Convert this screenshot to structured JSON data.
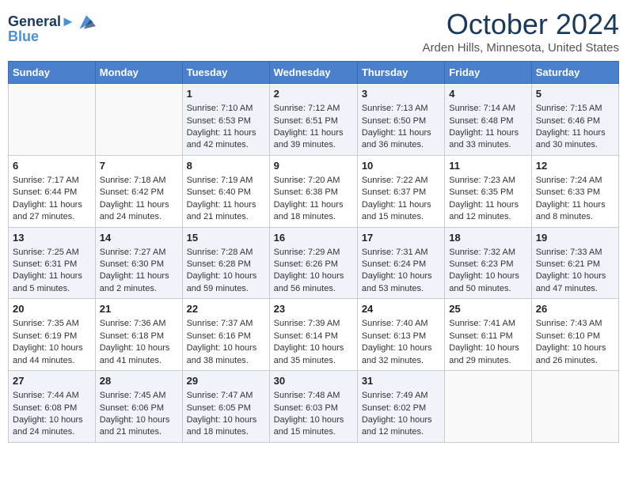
{
  "header": {
    "logo_line1": "General",
    "logo_line2": "Blue",
    "month_title": "October 2024",
    "location": "Arden Hills, Minnesota, United States"
  },
  "days_of_week": [
    "Sunday",
    "Monday",
    "Tuesday",
    "Wednesday",
    "Thursday",
    "Friday",
    "Saturday"
  ],
  "weeks": [
    [
      {
        "day": "",
        "sunrise": "",
        "sunset": "",
        "daylight": ""
      },
      {
        "day": "",
        "sunrise": "",
        "sunset": "",
        "daylight": ""
      },
      {
        "day": "1",
        "sunrise": "Sunrise: 7:10 AM",
        "sunset": "Sunset: 6:53 PM",
        "daylight": "Daylight: 11 hours and 42 minutes."
      },
      {
        "day": "2",
        "sunrise": "Sunrise: 7:12 AM",
        "sunset": "Sunset: 6:51 PM",
        "daylight": "Daylight: 11 hours and 39 minutes."
      },
      {
        "day": "3",
        "sunrise": "Sunrise: 7:13 AM",
        "sunset": "Sunset: 6:50 PM",
        "daylight": "Daylight: 11 hours and 36 minutes."
      },
      {
        "day": "4",
        "sunrise": "Sunrise: 7:14 AM",
        "sunset": "Sunset: 6:48 PM",
        "daylight": "Daylight: 11 hours and 33 minutes."
      },
      {
        "day": "5",
        "sunrise": "Sunrise: 7:15 AM",
        "sunset": "Sunset: 6:46 PM",
        "daylight": "Daylight: 11 hours and 30 minutes."
      }
    ],
    [
      {
        "day": "6",
        "sunrise": "Sunrise: 7:17 AM",
        "sunset": "Sunset: 6:44 PM",
        "daylight": "Daylight: 11 hours and 27 minutes."
      },
      {
        "day": "7",
        "sunrise": "Sunrise: 7:18 AM",
        "sunset": "Sunset: 6:42 PM",
        "daylight": "Daylight: 11 hours and 24 minutes."
      },
      {
        "day": "8",
        "sunrise": "Sunrise: 7:19 AM",
        "sunset": "Sunset: 6:40 PM",
        "daylight": "Daylight: 11 hours and 21 minutes."
      },
      {
        "day": "9",
        "sunrise": "Sunrise: 7:20 AM",
        "sunset": "Sunset: 6:38 PM",
        "daylight": "Daylight: 11 hours and 18 minutes."
      },
      {
        "day": "10",
        "sunrise": "Sunrise: 7:22 AM",
        "sunset": "Sunset: 6:37 PM",
        "daylight": "Daylight: 11 hours and 15 minutes."
      },
      {
        "day": "11",
        "sunrise": "Sunrise: 7:23 AM",
        "sunset": "Sunset: 6:35 PM",
        "daylight": "Daylight: 11 hours and 12 minutes."
      },
      {
        "day": "12",
        "sunrise": "Sunrise: 7:24 AM",
        "sunset": "Sunset: 6:33 PM",
        "daylight": "Daylight: 11 hours and 8 minutes."
      }
    ],
    [
      {
        "day": "13",
        "sunrise": "Sunrise: 7:25 AM",
        "sunset": "Sunset: 6:31 PM",
        "daylight": "Daylight: 11 hours and 5 minutes."
      },
      {
        "day": "14",
        "sunrise": "Sunrise: 7:27 AM",
        "sunset": "Sunset: 6:30 PM",
        "daylight": "Daylight: 11 hours and 2 minutes."
      },
      {
        "day": "15",
        "sunrise": "Sunrise: 7:28 AM",
        "sunset": "Sunset: 6:28 PM",
        "daylight": "Daylight: 10 hours and 59 minutes."
      },
      {
        "day": "16",
        "sunrise": "Sunrise: 7:29 AM",
        "sunset": "Sunset: 6:26 PM",
        "daylight": "Daylight: 10 hours and 56 minutes."
      },
      {
        "day": "17",
        "sunrise": "Sunrise: 7:31 AM",
        "sunset": "Sunset: 6:24 PM",
        "daylight": "Daylight: 10 hours and 53 minutes."
      },
      {
        "day": "18",
        "sunrise": "Sunrise: 7:32 AM",
        "sunset": "Sunset: 6:23 PM",
        "daylight": "Daylight: 10 hours and 50 minutes."
      },
      {
        "day": "19",
        "sunrise": "Sunrise: 7:33 AM",
        "sunset": "Sunset: 6:21 PM",
        "daylight": "Daylight: 10 hours and 47 minutes."
      }
    ],
    [
      {
        "day": "20",
        "sunrise": "Sunrise: 7:35 AM",
        "sunset": "Sunset: 6:19 PM",
        "daylight": "Daylight: 10 hours and 44 minutes."
      },
      {
        "day": "21",
        "sunrise": "Sunrise: 7:36 AM",
        "sunset": "Sunset: 6:18 PM",
        "daylight": "Daylight: 10 hours and 41 minutes."
      },
      {
        "day": "22",
        "sunrise": "Sunrise: 7:37 AM",
        "sunset": "Sunset: 6:16 PM",
        "daylight": "Daylight: 10 hours and 38 minutes."
      },
      {
        "day": "23",
        "sunrise": "Sunrise: 7:39 AM",
        "sunset": "Sunset: 6:14 PM",
        "daylight": "Daylight: 10 hours and 35 minutes."
      },
      {
        "day": "24",
        "sunrise": "Sunrise: 7:40 AM",
        "sunset": "Sunset: 6:13 PM",
        "daylight": "Daylight: 10 hours and 32 minutes."
      },
      {
        "day": "25",
        "sunrise": "Sunrise: 7:41 AM",
        "sunset": "Sunset: 6:11 PM",
        "daylight": "Daylight: 10 hours and 29 minutes."
      },
      {
        "day": "26",
        "sunrise": "Sunrise: 7:43 AM",
        "sunset": "Sunset: 6:10 PM",
        "daylight": "Daylight: 10 hours and 26 minutes."
      }
    ],
    [
      {
        "day": "27",
        "sunrise": "Sunrise: 7:44 AM",
        "sunset": "Sunset: 6:08 PM",
        "daylight": "Daylight: 10 hours and 24 minutes."
      },
      {
        "day": "28",
        "sunrise": "Sunrise: 7:45 AM",
        "sunset": "Sunset: 6:06 PM",
        "daylight": "Daylight: 10 hours and 21 minutes."
      },
      {
        "day": "29",
        "sunrise": "Sunrise: 7:47 AM",
        "sunset": "Sunset: 6:05 PM",
        "daylight": "Daylight: 10 hours and 18 minutes."
      },
      {
        "day": "30",
        "sunrise": "Sunrise: 7:48 AM",
        "sunset": "Sunset: 6:03 PM",
        "daylight": "Daylight: 10 hours and 15 minutes."
      },
      {
        "day": "31",
        "sunrise": "Sunrise: 7:49 AM",
        "sunset": "Sunset: 6:02 PM",
        "daylight": "Daylight: 10 hours and 12 minutes."
      },
      {
        "day": "",
        "sunrise": "",
        "sunset": "",
        "daylight": ""
      },
      {
        "day": "",
        "sunrise": "",
        "sunset": "",
        "daylight": ""
      }
    ]
  ]
}
